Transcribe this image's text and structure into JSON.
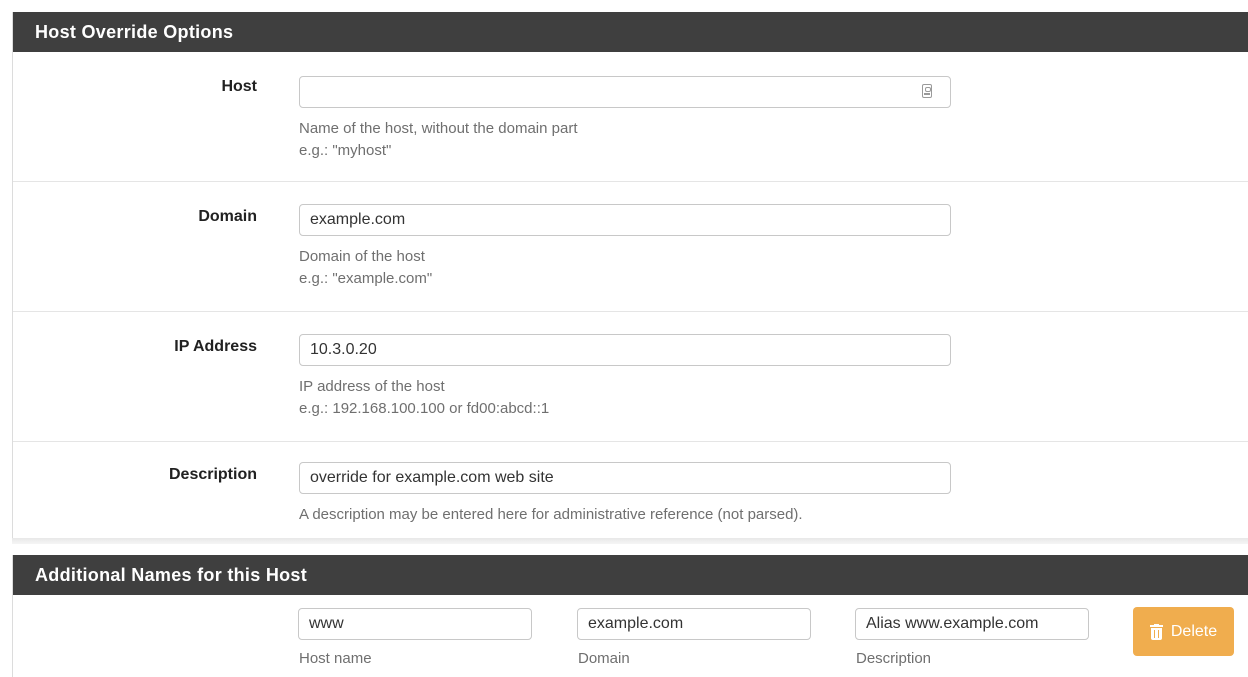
{
  "host_override": {
    "title": "Host Override Options",
    "fields": {
      "host": {
        "label": "Host",
        "value": "",
        "help1": "Name of the host, without the domain part",
        "help2": "e.g.: \"myhost\""
      },
      "domain": {
        "label": "Domain",
        "value": "example.com",
        "help1": "Domain of the host",
        "help2": "e.g.: \"example.com\""
      },
      "ip": {
        "label": "IP Address",
        "value": "10.3.0.20",
        "help1": "IP address of the host",
        "help2": "e.g.: 192.168.100.100 or fd00:abcd::1"
      },
      "description": {
        "label": "Description",
        "value": "override for example.com web site",
        "help1": "A description may be entered here for administrative reference (not parsed)."
      }
    }
  },
  "additional_names": {
    "title": "Additional Names for this Host",
    "row": {
      "host_value": "www",
      "domain_value": "example.com",
      "description_value": "Alias www.example.com",
      "host_help": "Host name",
      "domain_help": "Domain",
      "description_help": "Description",
      "delete_label": "Delete"
    }
  },
  "colors": {
    "panel_heading_bg": "#3f3f3f",
    "delete_button_bg": "#f0ad4e"
  }
}
